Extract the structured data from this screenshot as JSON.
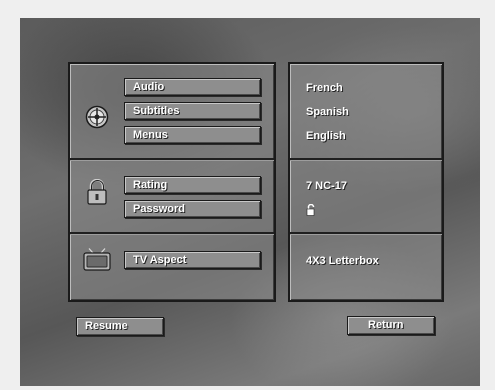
{
  "menu": {
    "audio_label": "Audio",
    "subtitles_label": "Subtitles",
    "menus_label": "Menus",
    "rating_label": "Rating",
    "password_label": "Password",
    "tv_aspect_label": "TV Aspect"
  },
  "values": {
    "audio": "French",
    "subtitles": "Spanish",
    "menus": "English",
    "rating": "7 NC-17",
    "tv_aspect": "4X3 Letterbox"
  },
  "footer": {
    "resume_label": "Resume",
    "return_label": "Return"
  },
  "icons": {
    "language": "disc-crosshair-icon",
    "lock": "padlock-icon",
    "password_state": "unlocked-padlock-icon",
    "tv": "tv-icon"
  }
}
